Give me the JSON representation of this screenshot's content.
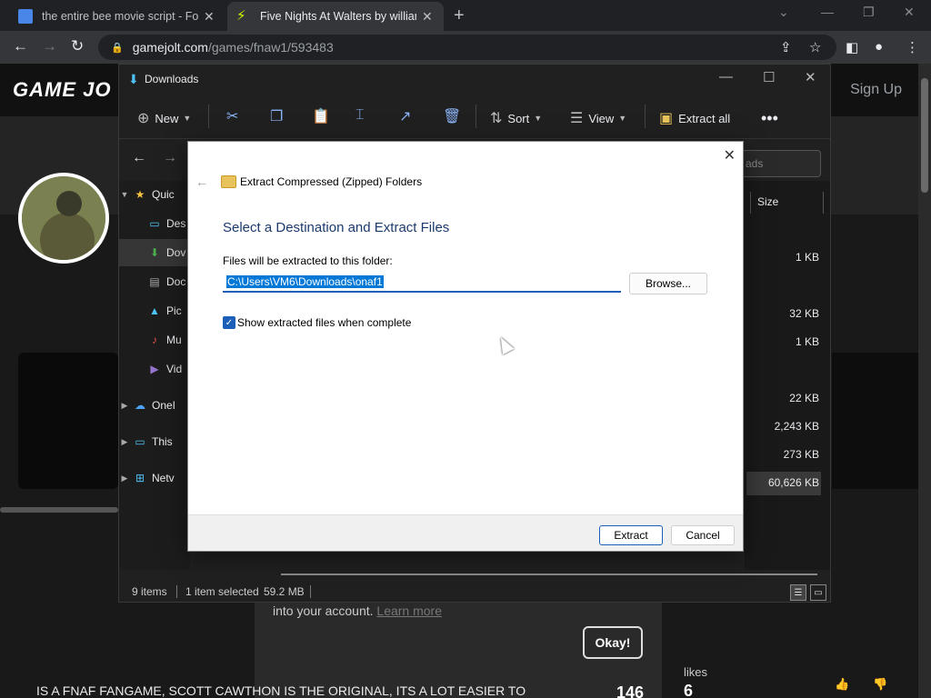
{
  "browser": {
    "tabs": [
      {
        "title": "the entire bee movie script - Forc",
        "active": false
      },
      {
        "title": "Five Nights At Walters by william",
        "active": true
      }
    ],
    "url_host": "gamejolt.com",
    "url_path": "/games/fnaw1/593483"
  },
  "site": {
    "logo": "GAME JO",
    "signup": "Sign Up",
    "notice_text": "into your account.",
    "notice_link": "Learn more",
    "okay": "Okay!",
    "footer_text": "IS A FNAF FANGAME, SCOTT CAWTHON IS THE ORIGINAL, ITS A LOT EASIER TO",
    "stat_value": "146",
    "likes_label": "likes",
    "likes_value": "6"
  },
  "explorer": {
    "title": "Downloads",
    "commands": {
      "new": "New",
      "sort": "Sort",
      "view": "View",
      "extract_all": "Extract all"
    },
    "search_placeholder": "ads",
    "col_size": "Size",
    "nav": [
      {
        "label": "Quic",
        "icon": "star-icon"
      },
      {
        "label": "Des",
        "icon": "desktop-icon"
      },
      {
        "label": "Dov",
        "icon": "download-icon"
      },
      {
        "label": "Doc",
        "icon": "document-icon"
      },
      {
        "label": "Pic",
        "icon": "picture-icon"
      },
      {
        "label": "Mu",
        "icon": "music-icon"
      },
      {
        "label": "Vid",
        "icon": "video-icon"
      },
      {
        "label": "OneI",
        "icon": "cloud-icon"
      },
      {
        "label": "This",
        "icon": "computer-icon"
      },
      {
        "label": "Netv",
        "icon": "network-icon"
      }
    ],
    "sizes": [
      "1 KB",
      "32 KB",
      "1 KB",
      "22 KB",
      "2,243 KB",
      "273 KB",
      "60,626 KB"
    ],
    "status": {
      "items": "9 items",
      "selected": "1 item selected",
      "size": "59.2 MB"
    }
  },
  "dialog": {
    "wizard_title": "Extract Compressed (Zipped) Folders",
    "heading": "Select a Destination and Extract Files",
    "folder_label": "Files will be extracted to this folder:",
    "folder_path": "C:\\Users\\VM6\\Downloads\\onaf1",
    "browse": "Browse...",
    "show_files_label": "Show extracted files when complete",
    "show_files_checked": true,
    "extract": "Extract",
    "cancel": "Cancel"
  }
}
